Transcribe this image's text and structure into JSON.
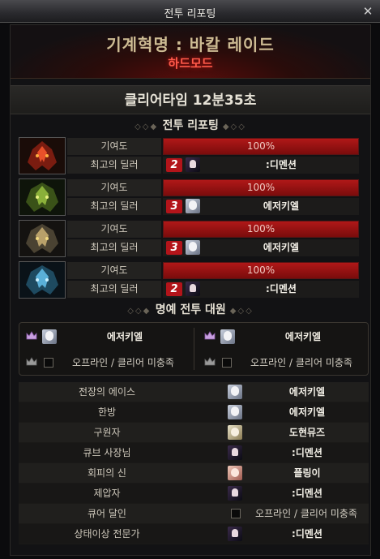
{
  "window": {
    "title": "전투 리포팅"
  },
  "dungeon": {
    "name": "기계혁명 : 바칼 레이드",
    "mode": "하드모드"
  },
  "clear_time": "클리어타임   12분35초",
  "sections": {
    "report": "전투 리포팅",
    "honor": "명예 전투 대원"
  },
  "report_labels": {
    "contribution": "기여도",
    "top_dealer": "최고의 딜러"
  },
  "reports": [
    {
      "portrait_icon": "red-dragon-icon",
      "contribution_text": "100%",
      "contribution_value": 1.0,
      "rank": "2",
      "avatar_icon": "demon-avatar",
      "dealer": ":디멘션"
    },
    {
      "portrait_icon": "green-dragon-icon",
      "contribution_text": "100%",
      "contribution_value": 1.0,
      "rank": "3",
      "avatar_icon": "knight-avatar",
      "dealer": "에저키엘"
    },
    {
      "portrait_icon": "gold-dragon-icon",
      "contribution_text": "100%",
      "contribution_value": 1.0,
      "rank": "3",
      "avatar_icon": "knight-avatar",
      "dealer": "에저키엘"
    },
    {
      "portrait_icon": "blue-dragon-icon",
      "contribution_text": "100%",
      "contribution_value": 1.0,
      "rank": "2",
      "avatar_icon": "demon-avatar",
      "dealer": ":디멘션"
    }
  ],
  "honor": {
    "slots": [
      {
        "name": "에저키엘",
        "avatar_icon": "knight-avatar"
      },
      {
        "name": "에저키엘",
        "avatar_icon": "knight-avatar"
      },
      {
        "offline_text": "오프라인 / 클리어 미충족"
      },
      {
        "offline_text": "오프라인 / 클리어 미충족"
      }
    ]
  },
  "awards": [
    {
      "label": "전장의 에이스",
      "avatar_icon": "knight-avatar",
      "name": "에저키엘"
    },
    {
      "label": "한방",
      "avatar_icon": "knight-avatar",
      "name": "에저키엘"
    },
    {
      "label": "구원자",
      "avatar_icon": "cleric-avatar",
      "name": "도현뮤즈"
    },
    {
      "label": "큐브 사장님",
      "avatar_icon": "demon-avatar",
      "name": ":디멘션"
    },
    {
      "label": "회피의 신",
      "avatar_icon": "pink-avatar",
      "name": "플링이"
    },
    {
      "label": "제압자",
      "avatar_icon": "demon-avatar",
      "name": ":디멘션"
    },
    {
      "label": "큐어 달인",
      "offline_text": "오프라인 / 클리어 미충족"
    },
    {
      "label": "상태이상 전문가",
      "avatar_icon": "demon-avatar",
      "name": ":디멘션"
    }
  ],
  "colors": {
    "red_dragon": "#c8301c",
    "green_dragon": "#6a8a2a",
    "gold_dragon": "#a08a52",
    "blue_dragon": "#3c7a9c",
    "bar_fill": "#b01818",
    "hard_mode": "#ff5a4a"
  }
}
